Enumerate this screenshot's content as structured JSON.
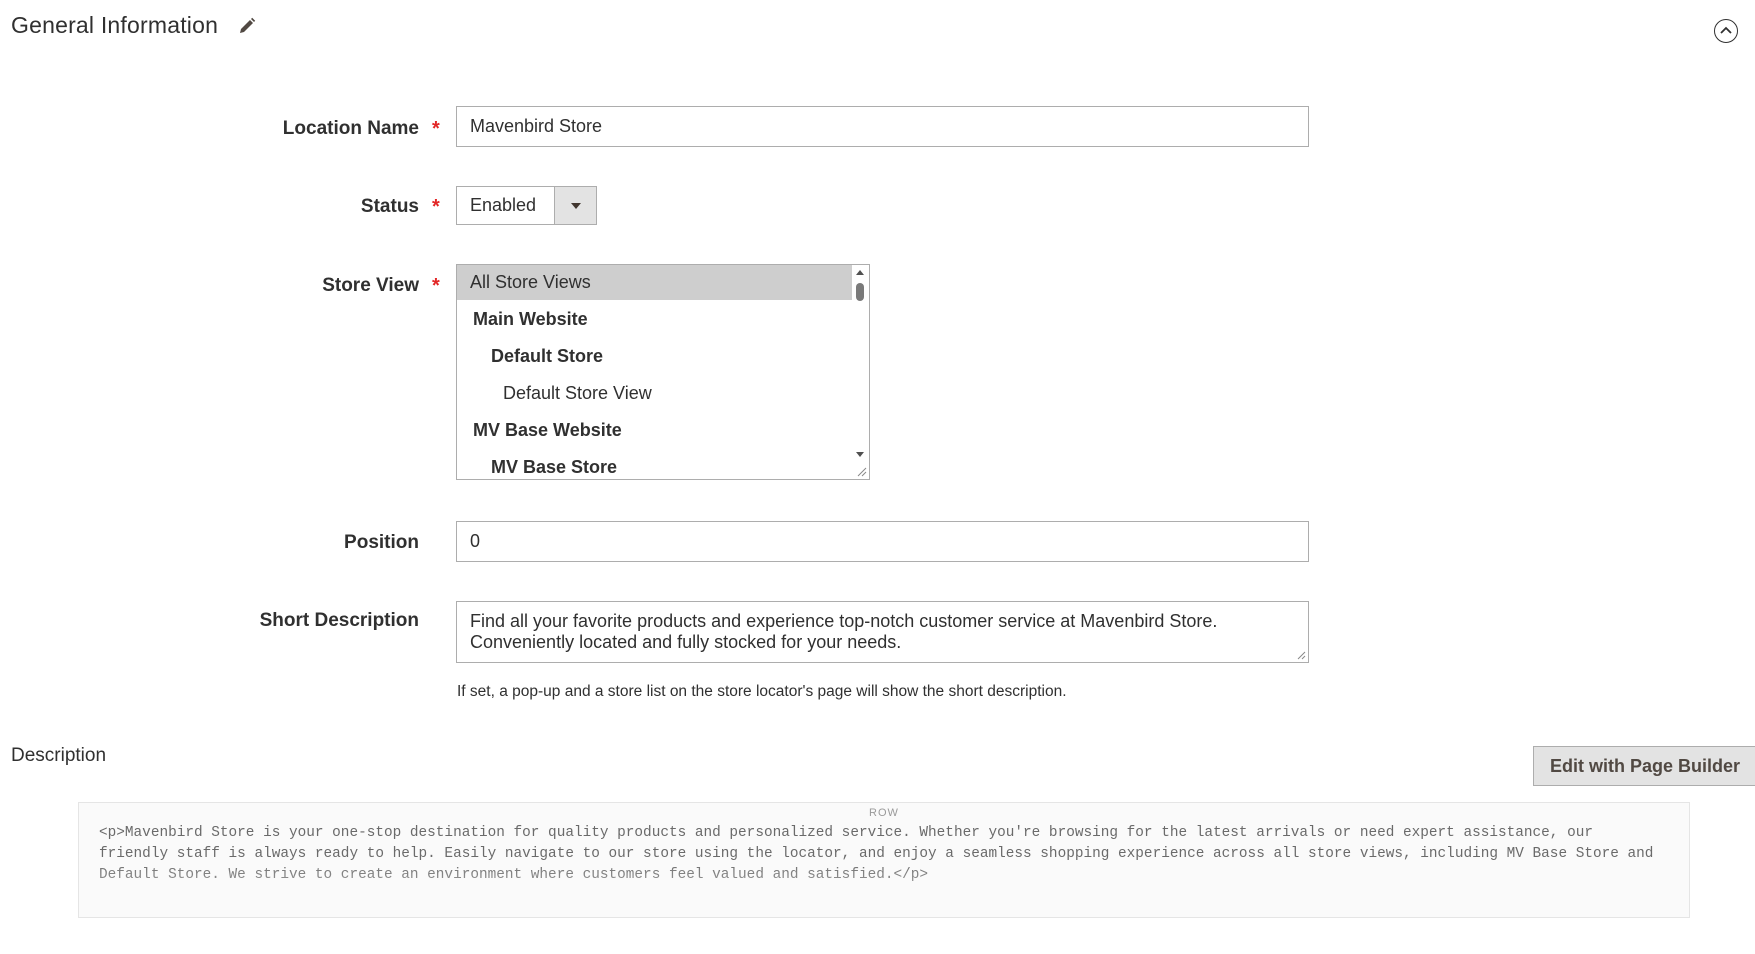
{
  "section": {
    "title": "General Information"
  },
  "fields": {
    "location_name": {
      "label": "Location Name",
      "value": "Mavenbird Store"
    },
    "status": {
      "label": "Status",
      "value": "Enabled"
    },
    "store_view": {
      "label": "Store View",
      "options": [
        "All Store Views",
        "Main Website",
        "Default Store",
        "Default Store View",
        "MV Base Website",
        "MV Base Store"
      ],
      "selected": "All Store Views"
    },
    "position": {
      "label": "Position",
      "value": "0"
    },
    "short_description": {
      "label": "Short Description",
      "value": "Find all your favorite products and experience top-notch customer service at Mavenbird Store. Conveniently located and fully stocked for your needs.",
      "note": "If set, a pop-up and a store list on the store locator's page will show the short description."
    },
    "required_mark": "*"
  },
  "description": {
    "label": "Description",
    "button_label": "Edit with Page Builder",
    "row_label": "ROW",
    "html": "<p>Mavenbird Store is your one-stop destination for quality products and personalized service. Whether you're browsing for the latest arrivals or need expert assistance, our friendly staff is always ready to help. Easily navigate to our store using the locator, and enjoy a seamless shopping experience across all store views, including MV Base Store and Default Store. We strive to create an environment where customers feel valued and satisfied.</p>"
  },
  "colors": {
    "required": "#e22626",
    "border": "#adadad",
    "selected_option": "#cecece",
    "button_bg": "#e3e3e3"
  }
}
